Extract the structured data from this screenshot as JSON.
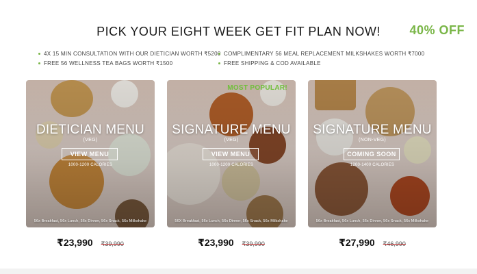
{
  "header": {
    "title": "PICK YOUR EIGHT WEEK GET FIT PLAN NOW!",
    "discount": "40% OFF"
  },
  "benefits": [
    "4X 15 MIN CONSULTATION WITH OUR DIETICIAN WORTH ₹5200",
    "COMPLIMENTARY 56 MEAL REPLACEMENT MILKSHAKES WORTH ₹7000",
    "FREE 56 WELLNESS TEA BAGS WORTH ₹1500",
    "FREE SHIPPING & COD AVAILABLE"
  ],
  "cards": [
    {
      "title": "DIETICIAN MENU",
      "subtitle": "(VEG)",
      "button": "VIEW MENU",
      "calories": "1000-1200 CALORIES",
      "meals": "56x Breakfast, 56x Lunch, 56x Dinner, 56x Snack, 56x Milkshake",
      "price": "₹23,990",
      "mrp": "₹39,990"
    },
    {
      "ribbon": "MOST POPULAR!",
      "title": "SIGNATURE MENU",
      "subtitle": "(VEG)",
      "button": "VIEW MENU",
      "calories": "1000-1200 CALORIES",
      "meals": "56X Breakfast, 56x Lunch, 56x Dinner, 56x Snack, 56x Milkshake",
      "price": "₹23,990",
      "mrp": "₹39,990"
    },
    {
      "title": "SIGNATURE MENU",
      "subtitle": "(NON-VEG)",
      "button": "COMING SOON",
      "calories": "1200-1400 CALORIES",
      "meals": "56x Breakfast, 56x Lunch, 56x Dinner, 56x Snack, 56x Milkshake",
      "price": "₹27,990",
      "mrp": "₹46,990"
    }
  ],
  "colors": {
    "accent": "#7ab648",
    "popular": "#6fbf3a",
    "strike": "#bb2222"
  }
}
